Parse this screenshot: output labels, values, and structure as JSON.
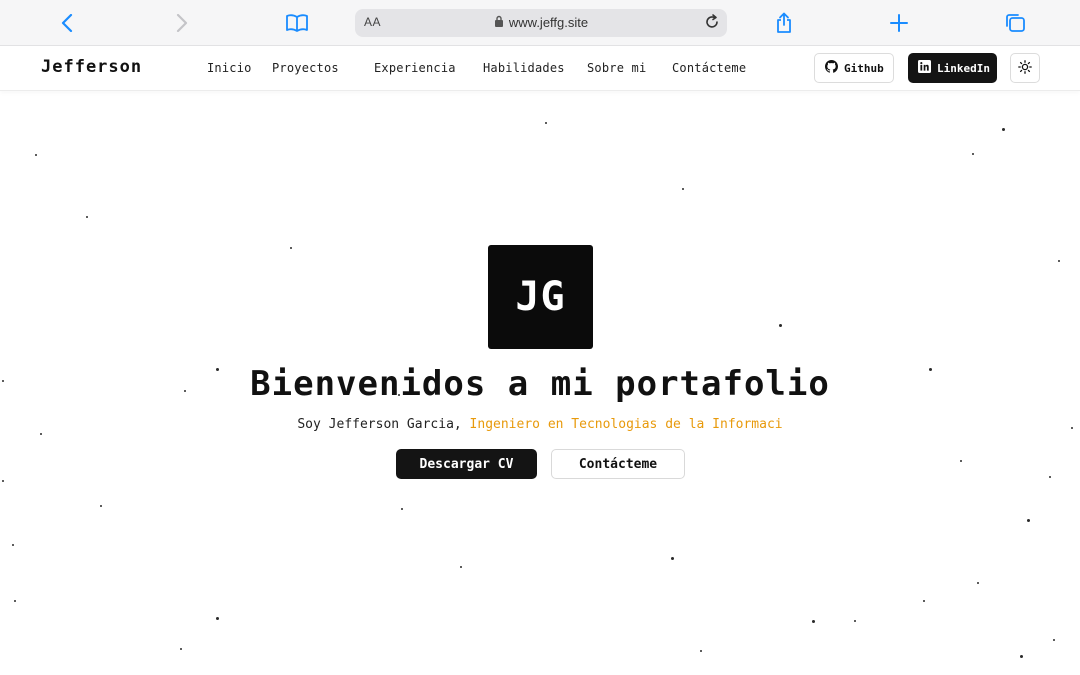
{
  "browser": {
    "aa_label": "AA",
    "url": "www.jeffg.site",
    "icons": [
      "back-icon",
      "forward-icon",
      "bookmarks-icon",
      "lock-icon",
      "reload-icon",
      "share-icon",
      "plus-icon",
      "tabs-icon"
    ],
    "accent": "#1a8cff"
  },
  "header": {
    "brand": "Jefferson",
    "nav": [
      "Inicio",
      "Proyectos",
      "Experiencia",
      "Habilidades",
      "Sobre mi",
      "Contácteme"
    ],
    "github_label": "Github",
    "linkedin_label": "LinkedIn",
    "theme_icon": "sun-icon"
  },
  "hero": {
    "logo_text": "JG",
    "title": "Bienvenidos a mi portafolio",
    "subtitle_prefix": "Soy Jefferson Garcia, ",
    "subtitle_accent": "Ingeniero en Tecnologias de la Informaci",
    "primary_cta": "Descargar CV",
    "secondary_cta": "Contácteme",
    "accent_color": "#e89a0c"
  }
}
